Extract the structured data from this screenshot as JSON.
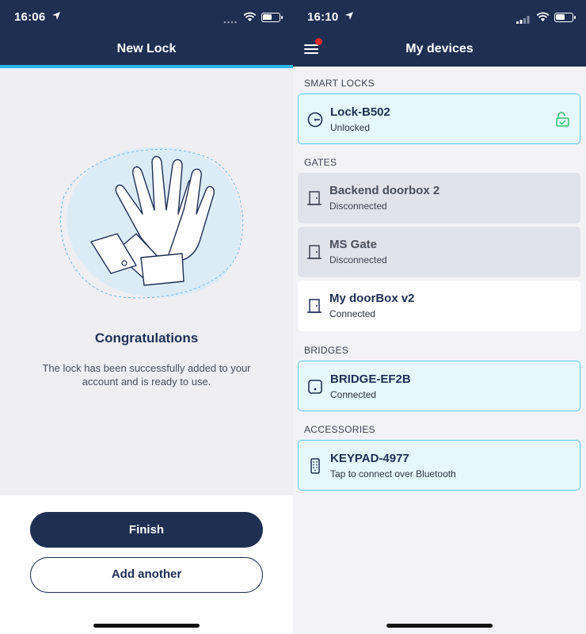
{
  "left": {
    "status": {
      "time": "16:06"
    },
    "title": "New Lock",
    "heading": "Congratulations",
    "message": "The lock has been successfully added to your account and is ready to use.",
    "finish_label": "Finish",
    "add_another_label": "Add another"
  },
  "right": {
    "status": {
      "time": "16:10"
    },
    "title": "My devices",
    "sections": {
      "smart_locks": "SMART LOCKS",
      "gates": "GATES",
      "bridges": "BRIDGES",
      "accessories": "ACCESSORIES"
    },
    "devices": {
      "lock": {
        "name": "Lock-B502",
        "status": "Unlocked",
        "icon": "lock-icon",
        "status_icon": "unlocked-padlock-icon"
      },
      "gate1": {
        "name": "Backend doorbox 2",
        "status": "Disconnected",
        "icon": "door-icon"
      },
      "gate2": {
        "name": "MS Gate",
        "status": "Disconnected",
        "icon": "door-icon"
      },
      "gate3": {
        "name": "My doorBox v2",
        "status": "Connected",
        "icon": "door-icon"
      },
      "bridge": {
        "name": "BRIDGE-EF2B",
        "status": "Connected",
        "icon": "bridge-icon"
      },
      "keypad": {
        "name": "KEYPAD-4977",
        "status": "Tap to connect over Bluetooth",
        "icon": "keypad-icon"
      }
    }
  },
  "colors": {
    "navy": "#1e2f52",
    "accent_blue": "#25b8e9",
    "success_green": "#2fbf71",
    "notification_red": "#e42b2b"
  }
}
